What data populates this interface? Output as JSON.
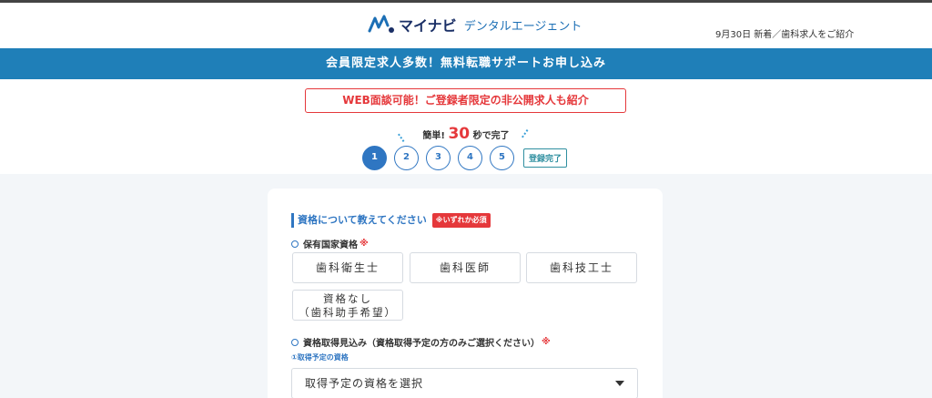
{
  "header": {
    "logo_main": "マイナビ",
    "logo_sub": "デンタルエージェント",
    "news": "9月30日 新着／歯科求人をご紹介",
    "logo_icon": "mynavi-logo-icon"
  },
  "banner": {
    "text": "会員限定求人多数！無料転職サポートお申し込み"
  },
  "notice": {
    "text": "WEB面談可能！ご登録者限定の非公開求人も紹介"
  },
  "easy": {
    "prefix": "簡単!",
    "seconds": "30",
    "suffix": "秒で完了"
  },
  "steps": {
    "items": [
      "1",
      "2",
      "3",
      "4",
      "5"
    ],
    "current": 1,
    "done_label": "登録完了"
  },
  "form": {
    "section_title": "資格について教えてください",
    "section_badge": "※いずれか必須",
    "q1_label": "保有国家資格",
    "q1_required": "※",
    "options": [
      "歯科衛生士",
      "歯科医師",
      "歯科技工士"
    ],
    "option_none_line1": "資格なし",
    "option_none_line2": "（歯科助手希望）",
    "q2_label": "資格取得見込み（資格取得予定の方のみご選択ください）",
    "q2_required": "※",
    "q2_sub_label": "①取得予定の資格",
    "select_placeholder": "取得予定の資格を選択"
  },
  "colors": {
    "brand_blue": "#1f7fb8",
    "accent_blue": "#2f76c2",
    "alert_red": "#e5383b",
    "page_bg": "#f3f6f9"
  }
}
